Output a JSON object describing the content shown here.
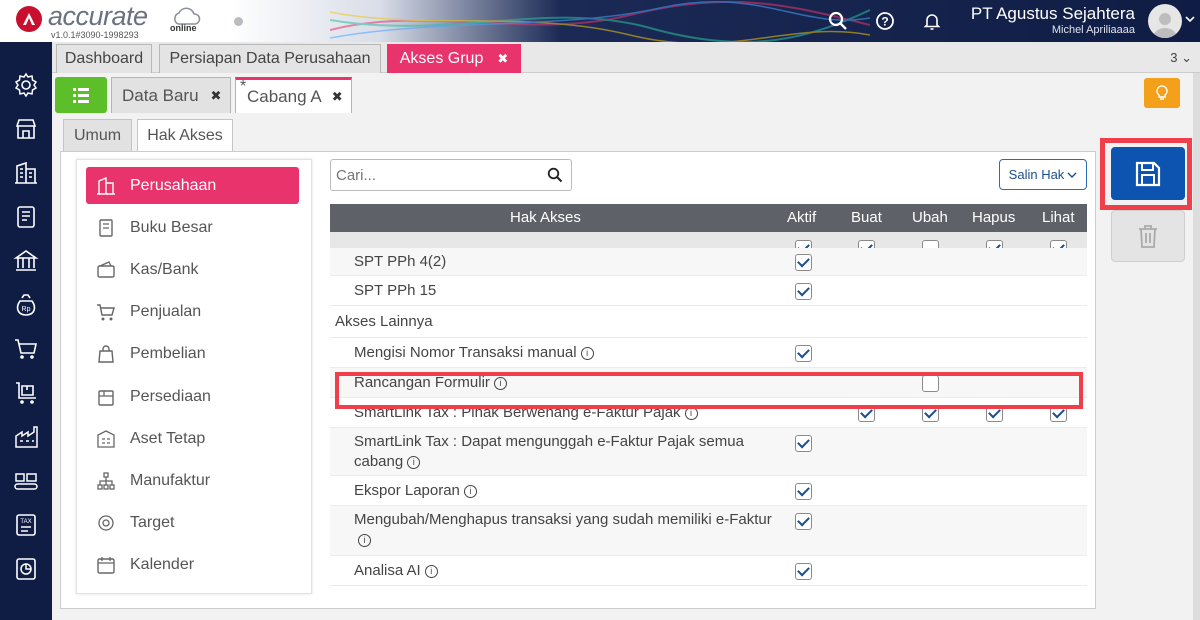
{
  "app": {
    "logo_text": "accurate",
    "logo_sub": "online",
    "version": "v1.0.1#3090-1998293",
    "company": "PT Agustus Sejahtera",
    "user": "Michel Apriliaaaa"
  },
  "sidebar_icons": [
    "gear-icon",
    "store-icon",
    "building-icon",
    "ledger-icon",
    "bank-icon",
    "money-bag-icon",
    "cart-icon",
    "purchase-icon",
    "factory-icon",
    "conveyor-icon",
    "tax-icon",
    "report-icon"
  ],
  "tabs": [
    {
      "label": "Dashboard"
    },
    {
      "label": "Persiapan Data Perusahaan"
    },
    {
      "label": "Akses Grup",
      "close": "✖"
    }
  ],
  "tab_count": "3",
  "subtabs": [
    {
      "label": "Data Baru",
      "close": "✖"
    },
    {
      "label": "Cabang A",
      "close": "✖",
      "modified": "*"
    }
  ],
  "inner_tabs": [
    {
      "label": "Umum"
    },
    {
      "label": "Hak Akses"
    }
  ],
  "categories": [
    {
      "label": "Perusahaan",
      "icon": "building-icon"
    },
    {
      "label": "Buku Besar",
      "icon": "book-icon"
    },
    {
      "label": "Kas/Bank",
      "icon": "wallet-icon"
    },
    {
      "label": "Penjualan",
      "icon": "cart-icon"
    },
    {
      "label": "Pembelian",
      "icon": "bag-icon"
    },
    {
      "label": "Persediaan",
      "icon": "inventory-icon"
    },
    {
      "label": "Aset Tetap",
      "icon": "asset-icon"
    },
    {
      "label": "Manufaktur",
      "icon": "hierarchy-icon"
    },
    {
      "label": "Target",
      "icon": "target-icon"
    },
    {
      "label": "Kalender",
      "icon": "calendar-icon"
    }
  ],
  "search": {
    "placeholder": "Cari..."
  },
  "salin_button": "Salin Hak",
  "table": {
    "headers": [
      "Hak Akses",
      "Aktif",
      "Buat",
      "Ubah",
      "Hapus",
      "Lihat"
    ],
    "select_all": [
      true,
      true,
      false,
      true,
      true
    ],
    "rows": [
      {
        "label": "SPT PPh 4(2)",
        "info": false,
        "checks": [
          true,
          null,
          null,
          null,
          null
        ]
      },
      {
        "label": "SPT PPh 15",
        "info": false,
        "checks": [
          true,
          null,
          null,
          null,
          null
        ]
      },
      {
        "label": "Akses Lainnya",
        "section": true
      },
      {
        "label": "Mengisi Nomor Transaksi manual",
        "info": true,
        "checks": [
          true,
          null,
          null,
          null,
          null
        ]
      },
      {
        "label": "Rancangan Formulir",
        "info": true,
        "checks": [
          null,
          null,
          false,
          null,
          null
        ]
      },
      {
        "label": "SmartLink Tax : Pihak Berwenang e-Faktur Pajak",
        "info": true,
        "checks": [
          null,
          true,
          true,
          true,
          true
        ]
      },
      {
        "label": "SmartLink Tax : Dapat mengunggah e-Faktur Pajak semua cabang",
        "info": true,
        "checks": [
          true,
          null,
          null,
          null,
          null
        ]
      },
      {
        "label": "Ekspor Laporan",
        "info": true,
        "checks": [
          true,
          null,
          null,
          null,
          null
        ]
      },
      {
        "label": "Mengubah/Menghapus transaksi yang sudah memiliki e-Faktur",
        "info": true,
        "checks": [
          true,
          null,
          null,
          null,
          null
        ]
      },
      {
        "label": "Analisa AI",
        "info": true,
        "checks": [
          true,
          null,
          null,
          null,
          null
        ]
      }
    ]
  }
}
